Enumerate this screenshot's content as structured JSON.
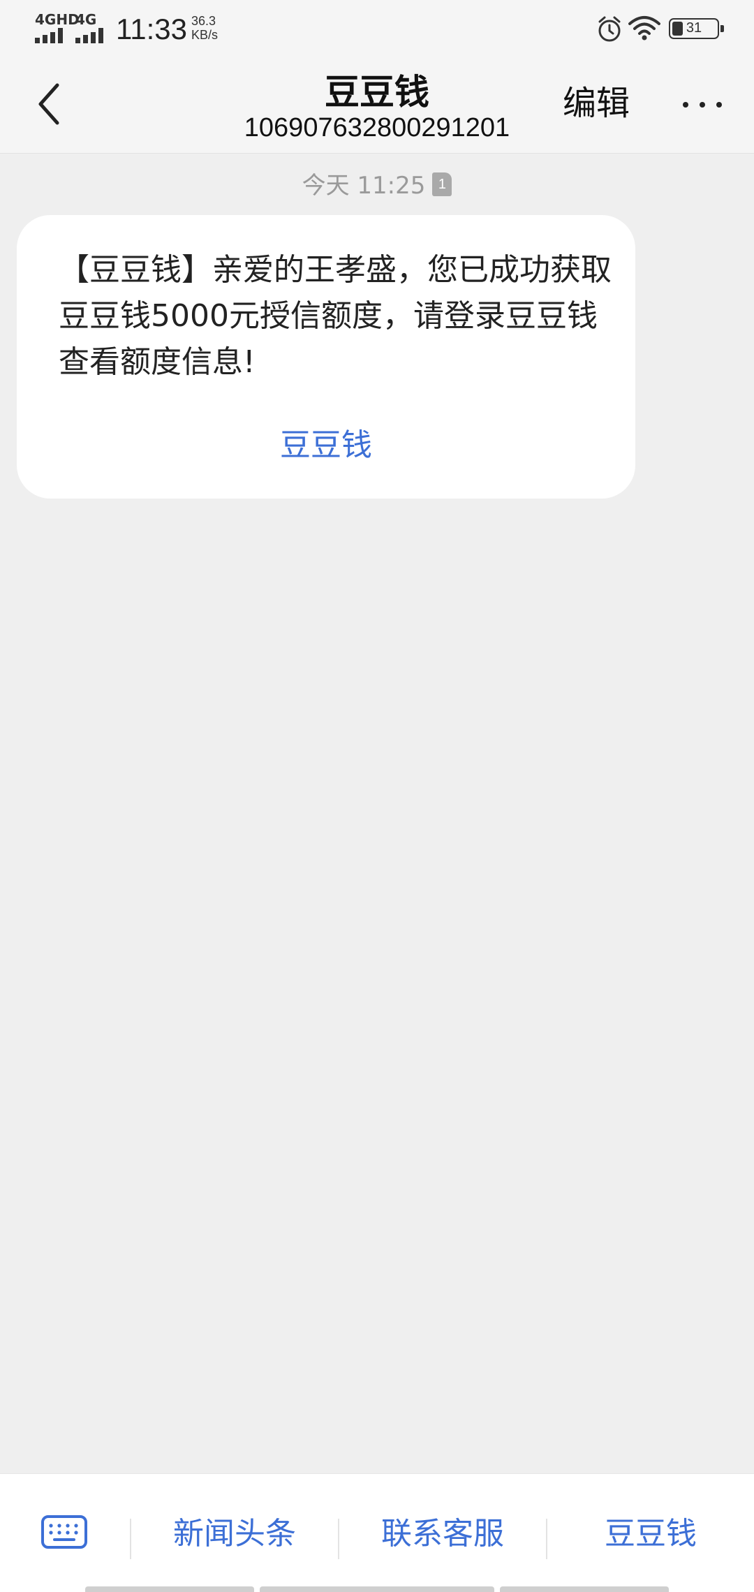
{
  "status_bar": {
    "network1": "4GHD",
    "network2": "4G",
    "time": "11:33",
    "speed_value": "36.3",
    "speed_unit": "KB/s",
    "battery_level": "31"
  },
  "header": {
    "title": "豆豆钱",
    "number": "106907632800291201",
    "edit_label": "编辑"
  },
  "conversation": {
    "timestamp": "今天 11:25",
    "sim_slot": "1",
    "message": {
      "text": "【豆豆钱】亲爱的王孝盛，您已成功获取豆豆钱5000元授信额度，请登录豆豆钱查看额度信息!",
      "link_label": "豆豆钱"
    }
  },
  "bottom_menu": {
    "items": [
      "新闻头条",
      "联系客服",
      "豆豆钱"
    ]
  },
  "colors": {
    "accent": "#3c6fd6",
    "background": "#efefef"
  }
}
